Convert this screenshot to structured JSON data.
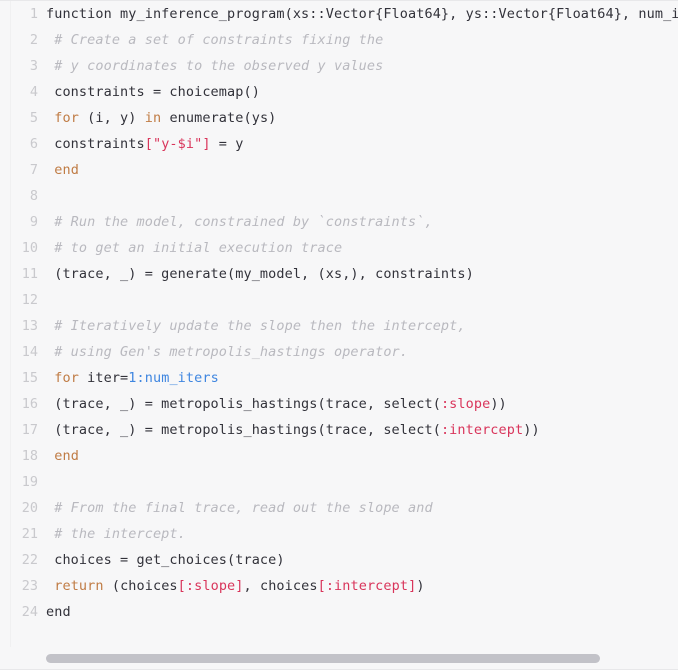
{
  "editor": {
    "language": "julia",
    "background_color": "#f7f7f8",
    "gutter_color": "#c9c9cd",
    "text_color": "#32323a",
    "first_line_number": 1,
    "last_line_number": 24,
    "total_lines": 24
  },
  "palette": {
    "keyword": "#c07c45",
    "comment": "#b9b9bf",
    "string": "#d9355b",
    "symbol": "#d9355b",
    "bracket": "#d9355b",
    "number": "#3f86e0",
    "plain": "#32323a"
  },
  "scrollbar": {
    "orientation": "horizontal",
    "thumb_color": "#c2c2c8",
    "track_color": "#f7f7f8"
  },
  "lines": [
    {
      "number": "1",
      "tokens": [
        {
          "t": "function my_inference_program(xs::Vector{Float64}, ys::Vector{Float64}, num_i",
          "c": "plain"
        }
      ]
    },
    {
      "number": "2",
      "tokens": [
        {
          "t": " # Create a set of constraints fixing the",
          "c": "comment"
        }
      ]
    },
    {
      "number": "3",
      "tokens": [
        {
          "t": " # y coordinates to the observed y values",
          "c": "comment"
        }
      ]
    },
    {
      "number": "4",
      "tokens": [
        {
          "t": " constraints = choicemap()",
          "c": "plain"
        }
      ]
    },
    {
      "number": "5",
      "tokens": [
        {
          "t": " ",
          "c": "plain"
        },
        {
          "t": "for",
          "c": "keyword"
        },
        {
          "t": " (i, y) ",
          "c": "plain"
        },
        {
          "t": "in",
          "c": "keyword"
        },
        {
          "t": " enumerate(ys)",
          "c": "plain"
        }
      ]
    },
    {
      "number": "6",
      "tokens": [
        {
          "t": " constraints",
          "c": "plain"
        },
        {
          "t": "[",
          "c": "bracket"
        },
        {
          "t": "\"y-$i\"",
          "c": "string"
        },
        {
          "t": "]",
          "c": "bracket"
        },
        {
          "t": " = y",
          "c": "plain"
        }
      ]
    },
    {
      "number": "7",
      "tokens": [
        {
          "t": " ",
          "c": "plain"
        },
        {
          "t": "end",
          "c": "keyword"
        }
      ]
    },
    {
      "number": "8",
      "tokens": []
    },
    {
      "number": "9",
      "tokens": [
        {
          "t": " # Run the model, constrained by `constraints`,",
          "c": "comment"
        }
      ]
    },
    {
      "number": "10",
      "tokens": [
        {
          "t": " # to get an initial execution trace",
          "c": "comment"
        }
      ]
    },
    {
      "number": "11",
      "tokens": [
        {
          "t": " (trace, _) = generate(my_model, (xs,), constraints)",
          "c": "plain"
        }
      ]
    },
    {
      "number": "12",
      "tokens": []
    },
    {
      "number": "13",
      "tokens": [
        {
          "t": " # Iteratively update the slope then the intercept,",
          "c": "comment"
        }
      ]
    },
    {
      "number": "14",
      "tokens": [
        {
          "t": " # using Gen's metropolis_hastings operator.",
          "c": "comment"
        }
      ]
    },
    {
      "number": "15",
      "tokens": [
        {
          "t": " ",
          "c": "plain"
        },
        {
          "t": "for",
          "c": "keyword"
        },
        {
          "t": " iter=",
          "c": "plain"
        },
        {
          "t": "1",
          "c": "number"
        },
        {
          "t": ":num_iters",
          "c": "range"
        }
      ]
    },
    {
      "number": "16",
      "tokens": [
        {
          "t": " (trace, _) = metropolis_hastings(trace, select(",
          "c": "plain"
        },
        {
          "t": ":slope",
          "c": "symbol"
        },
        {
          "t": "))",
          "c": "plain"
        }
      ]
    },
    {
      "number": "17",
      "tokens": [
        {
          "t": " (trace, _) = metropolis_hastings(trace, select(",
          "c": "plain"
        },
        {
          "t": ":intercept",
          "c": "symbol"
        },
        {
          "t": "))",
          "c": "plain"
        }
      ]
    },
    {
      "number": "18",
      "tokens": [
        {
          "t": " ",
          "c": "plain"
        },
        {
          "t": "end",
          "c": "keyword"
        }
      ]
    },
    {
      "number": "19",
      "tokens": []
    },
    {
      "number": "20",
      "tokens": [
        {
          "t": " # From the final trace, read out the slope and",
          "c": "comment"
        }
      ]
    },
    {
      "number": "21",
      "tokens": [
        {
          "t": " # the intercept.",
          "c": "comment"
        }
      ]
    },
    {
      "number": "22",
      "tokens": [
        {
          "t": " choices = get_choices(trace)",
          "c": "plain"
        }
      ]
    },
    {
      "number": "23",
      "tokens": [
        {
          "t": " ",
          "c": "plain"
        },
        {
          "t": "return",
          "c": "keyword"
        },
        {
          "t": " (choices",
          "c": "plain"
        },
        {
          "t": "[",
          "c": "bracket"
        },
        {
          "t": ":slope",
          "c": "symbol"
        },
        {
          "t": "]",
          "c": "bracket"
        },
        {
          "t": ", choices",
          "c": "plain"
        },
        {
          "t": "[",
          "c": "bracket"
        },
        {
          "t": ":intercept",
          "c": "symbol"
        },
        {
          "t": "]",
          "c": "bracket"
        },
        {
          "t": ")",
          "c": "plain"
        }
      ]
    },
    {
      "number": "24",
      "tokens": [
        {
          "t": "end",
          "c": "plain"
        }
      ]
    }
  ]
}
